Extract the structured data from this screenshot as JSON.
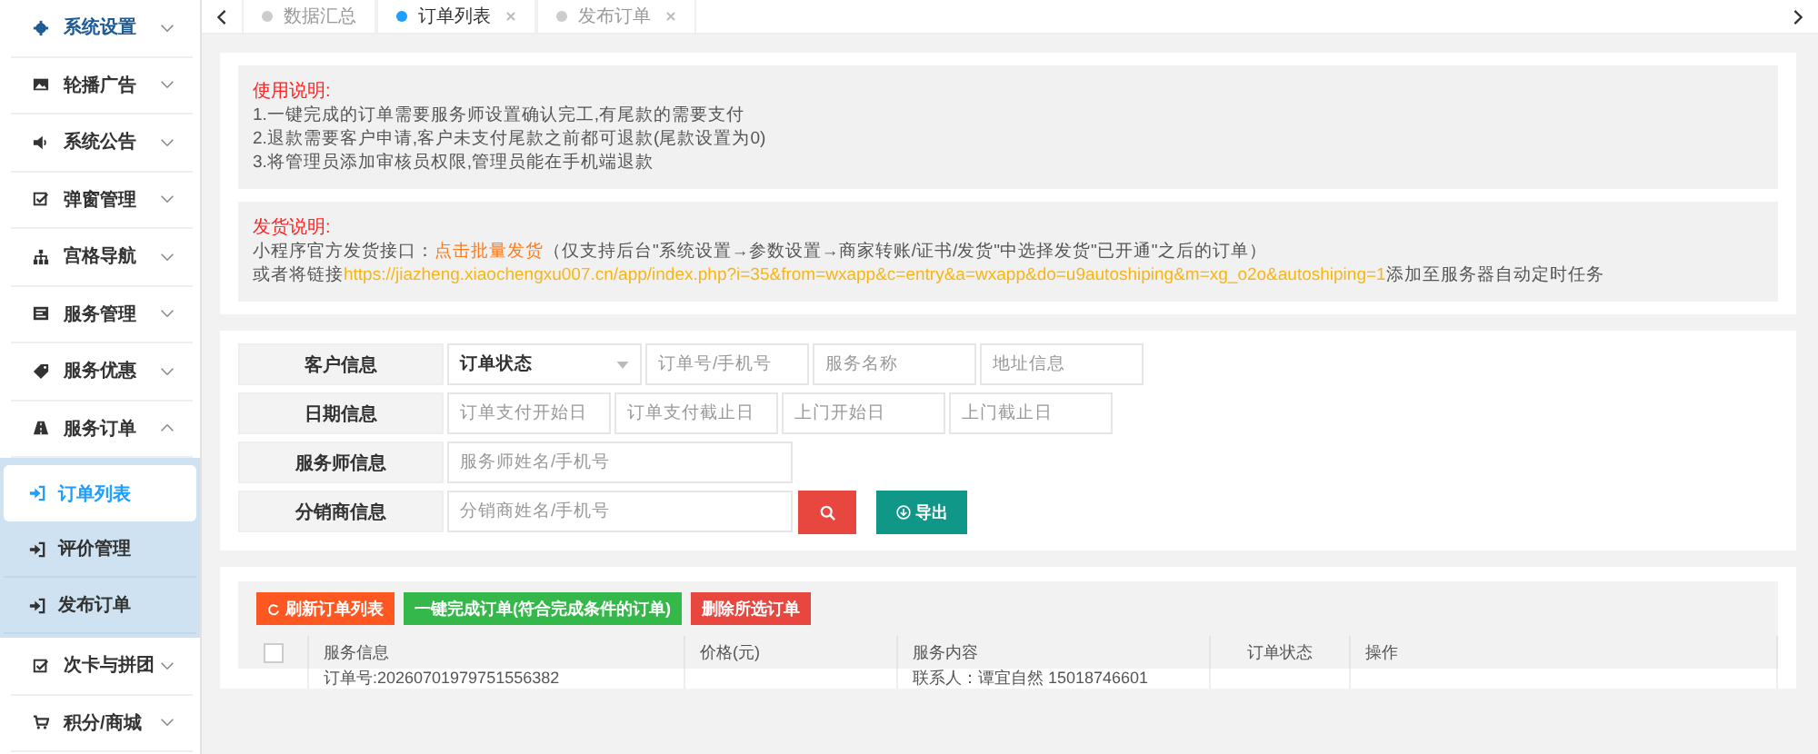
{
  "sidebar": {
    "items": [
      {
        "label": "系统设置",
        "active": true,
        "expanded": false
      },
      {
        "label": "轮播广告",
        "active": false,
        "expanded": false
      },
      {
        "label": "系统公告",
        "active": false,
        "expanded": false
      },
      {
        "label": "弹窗管理",
        "active": false,
        "expanded": false
      },
      {
        "label": "宫格导航",
        "active": false,
        "expanded": false
      },
      {
        "label": "服务管理",
        "active": false,
        "expanded": false
      },
      {
        "label": "服务优惠",
        "active": false,
        "expanded": false
      },
      {
        "label": "服务订单",
        "active": false,
        "expanded": true,
        "children": [
          {
            "label": "订单列表",
            "selected": true
          },
          {
            "label": "评价管理",
            "selected": false
          },
          {
            "label": "发布订单",
            "selected": false
          }
        ]
      },
      {
        "label": "次卡与拼团",
        "active": false,
        "expanded": false
      },
      {
        "label": "积分/商城",
        "active": false,
        "expanded": false
      }
    ]
  },
  "tabs": [
    {
      "label": "数据汇总",
      "selected": false,
      "closable": false
    },
    {
      "label": "订单列表",
      "selected": true,
      "closable": true
    },
    {
      "label": "发布订单",
      "selected": false,
      "closable": true
    }
  ],
  "notices": [
    {
      "title": "使用说明:",
      "lines": [
        [
          {
            "kind": "text",
            "text": "1.一键完成的订单需要服务师设置确认完工,有尾款的需要支付"
          }
        ],
        [
          {
            "kind": "text",
            "text": "2.退款需要客户申请,客户未支付尾款之前都可退款(尾款设置为0)"
          }
        ],
        [
          {
            "kind": "text",
            "text": "3.将管理员添加审核员权限,管理员能在手机端退款"
          }
        ]
      ]
    },
    {
      "title": "发货说明:",
      "lines": [
        [
          {
            "kind": "text",
            "text": "小程序官方发货接口："
          },
          {
            "kind": "link",
            "text": "点击批量发货"
          },
          {
            "kind": "text",
            "text": "（仅支持后台\"系统设置→参数设置→商家转账/证书/发货\"中选择发货\"已开通\"之后的订单）"
          }
        ],
        [
          {
            "kind": "text",
            "text": "或者将链接"
          },
          {
            "kind": "url",
            "text": "https://jiazheng.xiaochengxu007.cn/app/index.php?i=35&from=wxapp&c=entry&a=wxapp&do=u9autoshiping&m=xg_o2o&autoshiping=1"
          },
          {
            "kind": "text",
            "text": "添加至服务器自动定时任务"
          }
        ]
      ]
    }
  ],
  "filters": [
    {
      "label": "客户信息",
      "fields": [
        {
          "kind": "select",
          "value": "订单状态"
        },
        {
          "kind": "input",
          "placeholder": "订单号/手机号"
        },
        {
          "kind": "input",
          "placeholder": "服务名称"
        },
        {
          "kind": "input",
          "placeholder": "地址信息"
        }
      ]
    },
    {
      "label": "日期信息",
      "fields": [
        {
          "kind": "input",
          "placeholder": "订单支付开始日"
        },
        {
          "kind": "input",
          "placeholder": "订单支付截止日"
        },
        {
          "kind": "input",
          "placeholder": "上门开始日"
        },
        {
          "kind": "input",
          "placeholder": "上门截止日"
        }
      ]
    },
    {
      "label": "服务师信息",
      "fields": [
        {
          "kind": "wide",
          "placeholder": "服务师姓名/手机号"
        }
      ]
    },
    {
      "label": "分销商信息",
      "fields": [
        {
          "kind": "wide",
          "placeholder": "分销商姓名/手机号"
        },
        {
          "kind": "search"
        },
        {
          "kind": "export",
          "label": "导出"
        }
      ]
    }
  ],
  "toolbar": [
    {
      "label": "刷新订单列表",
      "color": "#ff5722",
      "refresh": true
    },
    {
      "label": "一键完成订单(符合完成条件的订单)",
      "color": "#35b84a",
      "refresh": false
    },
    {
      "label": "删除所选订单",
      "color": "#e8473f",
      "refresh": false
    }
  ],
  "table": {
    "select_all": {
      "checked": false
    },
    "columns": [
      "服务信息",
      "价格(元)",
      "服务内容",
      "订单状态",
      "操作"
    ],
    "rows": [
      {
        "cells": [
          "订单号:20260701979751556382",
          "",
          "联系人：谭宜自然 15018746601",
          "",
          ""
        ]
      }
    ]
  }
}
